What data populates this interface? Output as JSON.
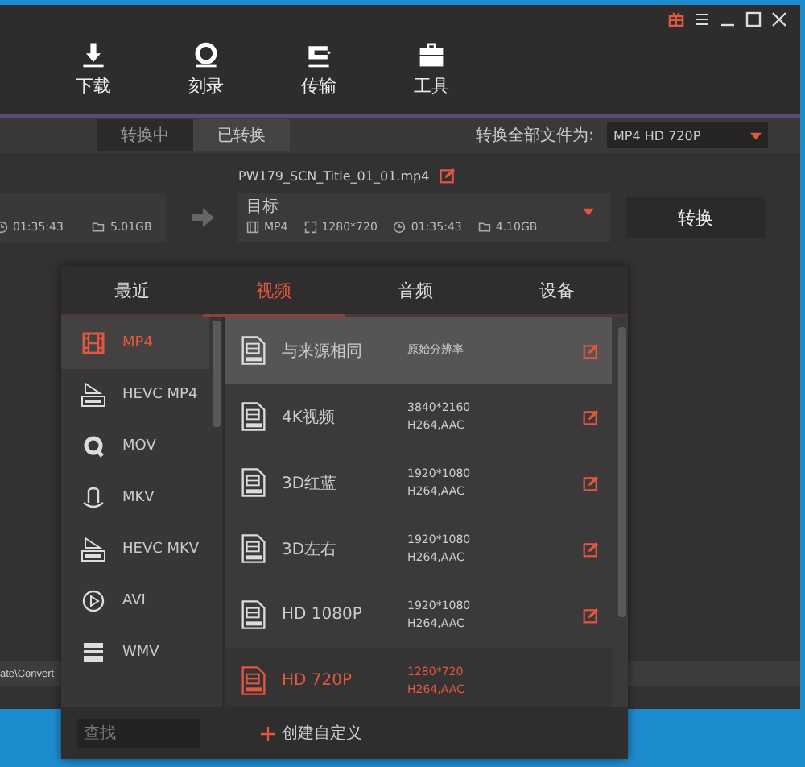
{
  "toolbar": [
    {
      "label": "下载",
      "kind": "download"
    },
    {
      "label": "刻录",
      "kind": "burn"
    },
    {
      "label": "传输",
      "kind": "transfer"
    },
    {
      "label": "工具",
      "kind": "toolbox"
    }
  ],
  "subtabs": [
    {
      "label": "转换中",
      "selected": true
    },
    {
      "label": "已转换",
      "selected": false
    }
  ],
  "convert_all": {
    "label": "转换全部文件为:",
    "value": "MP4 HD 720P"
  },
  "task": {
    "file_name": "PW179_SCN_Title_01_01.mp4",
    "source": {
      "duration": "01:35:43",
      "size": "5.01GB"
    },
    "target": {
      "label": "目标",
      "format": "MP4",
      "resolution": "1280*720",
      "duration": "01:35:43",
      "size": "4.10GB"
    },
    "convert_button": "转换"
  },
  "output_path": "ate\\Convert",
  "format_picker": {
    "tabs": [
      {
        "label": "最近",
        "selected": false
      },
      {
        "label": "视频",
        "selected": true
      },
      {
        "label": "音频",
        "selected": false
      },
      {
        "label": "设备",
        "selected": false
      }
    ],
    "formats": [
      {
        "label": "MP4",
        "kind": "film",
        "selected": true
      },
      {
        "label": "HEVC MP4",
        "kind": "hevc",
        "selected": false
      },
      {
        "label": "MOV",
        "kind": "quicktime",
        "selected": false
      },
      {
        "label": "MKV",
        "kind": "matroska",
        "selected": false
      },
      {
        "label": "HEVC MKV",
        "kind": "hevc",
        "selected": false
      },
      {
        "label": "AVI",
        "kind": "play",
        "selected": false
      },
      {
        "label": "WMV",
        "kind": "windows",
        "selected": false
      }
    ],
    "presets": [
      {
        "name": "与来源相同",
        "details": [
          "原始分辨率"
        ],
        "selected": false,
        "highlighted": true,
        "editable": true
      },
      {
        "name": "4K视频",
        "details": [
          "3840*2160",
          "H264,AAC"
        ],
        "selected": false,
        "highlighted": false,
        "editable": true
      },
      {
        "name": "3D红蓝",
        "details": [
          "1920*1080",
          "H264,AAC"
        ],
        "selected": false,
        "highlighted": false,
        "editable": true
      },
      {
        "name": "3D左右",
        "details": [
          "1920*1080",
          "H264,AAC"
        ],
        "selected": false,
        "highlighted": false,
        "editable": true
      },
      {
        "name": "HD 1080P",
        "details": [
          "1920*1080",
          "H264,AAC"
        ],
        "selected": false,
        "highlighted": false,
        "editable": true
      },
      {
        "name": "HD 720P",
        "details": [
          "1280*720",
          "H264,AAC"
        ],
        "selected": true,
        "highlighted": false,
        "editable": false
      }
    ],
    "search": {
      "placeholder": "查找"
    },
    "create_button": "创建自定义"
  }
}
